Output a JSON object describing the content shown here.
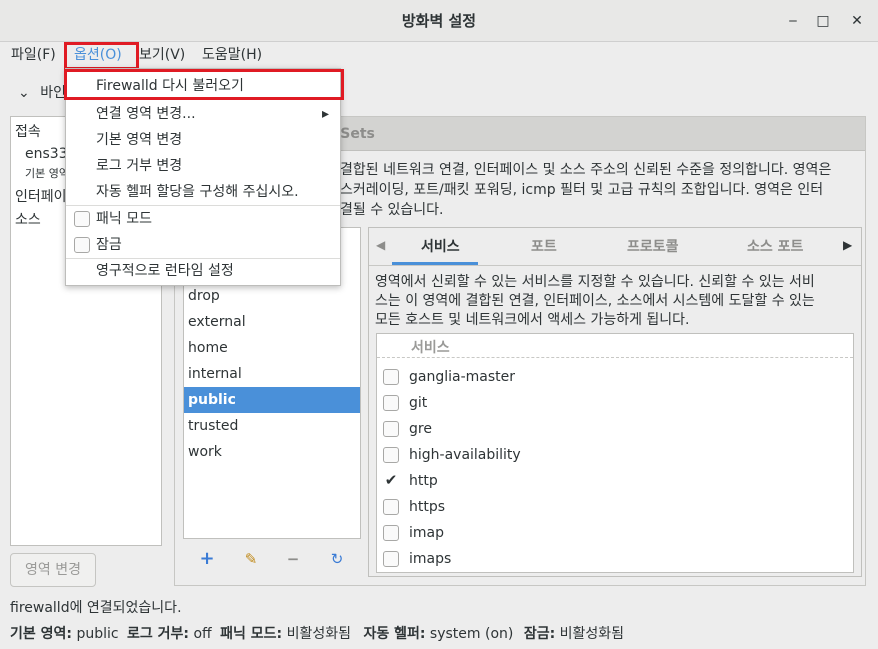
{
  "window": {
    "title": "방화벽 설정",
    "minimize_glyph": "‒",
    "maximize_glyph": "□",
    "close_glyph": "✕"
  },
  "menubar": {
    "items": [
      "파일(F)",
      "옵션(O)",
      "보기(V)",
      "도움말(H)"
    ],
    "active_index": 1
  },
  "options_menu": {
    "reload": "Firewalld 다시 불러오기",
    "change_connection_zone": "연결 영역 변경...",
    "change_default_zone": "기본 영역 변경",
    "change_log_denied": "로그 거부 변경",
    "auto_helper": "자동 헬퍼 할당을 구성해 주십시오.",
    "panic_mode": "패닉 모드",
    "lockdown": "잠금",
    "runtime_to_permanent": "영구적으로 런타임 설정",
    "submenu_arrow": "▸"
  },
  "left_panel": {
    "binding_label_fragment": "바인",
    "connections_header": "접속",
    "connection_name": "ens33",
    "connection_sub": "기본 영역",
    "interfaces_header": "인터페이",
    "sources_header": "소스",
    "zone_change_button": "영역 변경"
  },
  "main": {
    "ipsets_tab_fragment": "PSets",
    "zone_description_lines": [
      "결합된 네트워크 연결, 인터페이스 및 소스 주소의 신뢰된 수준을 정의합니다. 영역은",
      "스커레이딩, 포트/패킷 포워딩, icmp 필터 및 고급 규칙의 조합입니다. 영역은 인터",
      "결될 수 있습니다."
    ],
    "zones": [
      "drop",
      "external",
      "home",
      "internal",
      "public",
      "trusted",
      "work"
    ],
    "selected_zone": "public",
    "zone_tools": {
      "add": "+",
      "edit": "✎",
      "remove": "−",
      "reload": "↻"
    }
  },
  "services_panel": {
    "tabs": [
      "서비스",
      "포트",
      "프로토콜",
      "소스 포트"
    ],
    "active_tab": "서비스",
    "left_arrow": "◀",
    "right_arrow": "▶",
    "description_lines": [
      "영역에서 신뢰할 수 있는 서비스를 지정할 수 있습니다. 신뢰할 수 있는 서비",
      "스는 이 영역에 결합된 연결, 인터페이스, 소스에서 시스템에 도달할 수 있는",
      "모든 호스트 및 네트워크에서 액세스 가능하게 됩니다."
    ],
    "column_header": "서비스",
    "services": [
      {
        "name": "ganglia-master",
        "checked": false
      },
      {
        "name": "git",
        "checked": false
      },
      {
        "name": "gre",
        "checked": false
      },
      {
        "name": "high-availability",
        "checked": false
      },
      {
        "name": "http",
        "checked": true
      },
      {
        "name": "https",
        "checked": false
      },
      {
        "name": "imap",
        "checked": false
      },
      {
        "name": "imaps",
        "checked": false
      }
    ],
    "check_glyph": "✔"
  },
  "status": {
    "message": "firewalld에 연결되었습니다.",
    "default_zone_label": "기본 영역:",
    "default_zone_value": "public",
    "log_denied_label": "로그 거부:",
    "log_denied_value": "off",
    "panic_label": "패닉 모드:",
    "panic_value": "비활성화됨",
    "helper_label": "자동 헬퍼:",
    "helper_value": "system (on)",
    "lockdown_label": "잠금:",
    "lockdown_value": "비활성화됨"
  },
  "colors": {
    "accent": "#4a90d9",
    "annotation_red": "#e01b24"
  }
}
